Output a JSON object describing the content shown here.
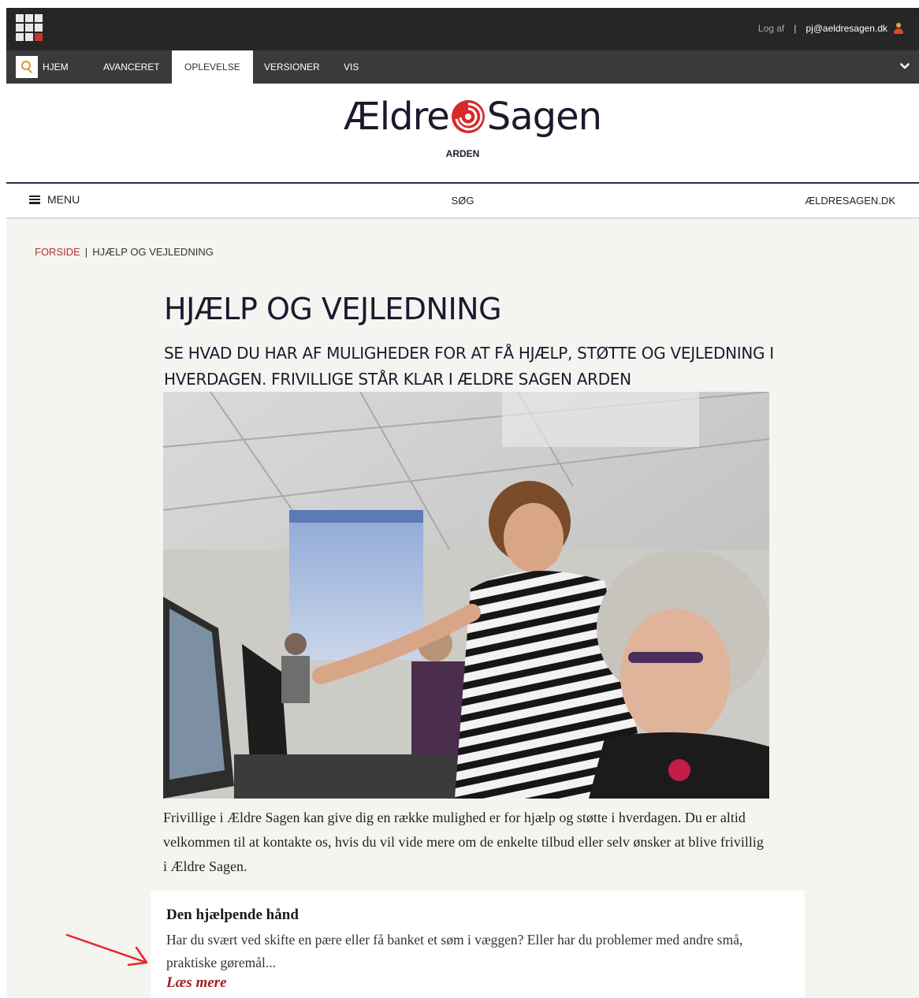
{
  "cms": {
    "logoff": "Log af",
    "separator": "|",
    "email": "pj@aeldresagen.dk",
    "tabs": [
      "HJEM",
      "AVANCERET",
      "OPLEVELSE",
      "VERSIONER",
      "VIS"
    ],
    "active_tab": "OPLEVELSE"
  },
  "site": {
    "logo_left": "Ældre",
    "logo_right": "Sagen",
    "department": "ARDEN",
    "menu_label": "MENU",
    "search_label": "SØG",
    "external_link": "ÆLDRESAGEN.DK"
  },
  "breadcrumb": {
    "home": "FORSIDE",
    "separator": "|",
    "current": "HJÆLP OG VEJLEDNING"
  },
  "page": {
    "title": "HJÆLP OG VEJLEDNING",
    "subtitle": "SE HVAD DU HAR AF MULIGHEDER FOR AT FÅ HJÆLP, STØTTE OG VEJLEDNING I HVERDAGEN. FRIVILLIGE STÅR KLAR I ÆLDRE SAGEN ARDEN",
    "intro": "Frivillige i Ældre Sagen kan give dig en række mulighed er for hjælp og støtte i hverdagen. Du er altid velkommen til at kontakte os, hvis du vil vide mere om de enkelte tilbud eller selv ønsker at blive frivillig i Ældre Sagen."
  },
  "card": {
    "title": "Den hjælpende hånd",
    "text": "Har du svært ved skifte en pære eller få banket et søm i væggen? Eller har du problemer med andre små, praktiske gøremål...",
    "link": "Læs mere"
  },
  "colors": {
    "cms_bar": "#262626",
    "cms_nav": "#3a3a3a",
    "brand_red": "#d62b2b",
    "breadcrumb_red": "#b03434",
    "link_red": "#a41e22",
    "page_bg": "#f4f4f1",
    "annotation_arrow": "#e8242a"
  },
  "icons": {
    "apps": "app-grid-icon",
    "search": "search-icon",
    "user": "user-icon",
    "chevron": "chevron-down-icon",
    "menu": "hamburger-icon",
    "logo": "spiral-logo-icon",
    "annotation": "red-arrow-icon"
  }
}
